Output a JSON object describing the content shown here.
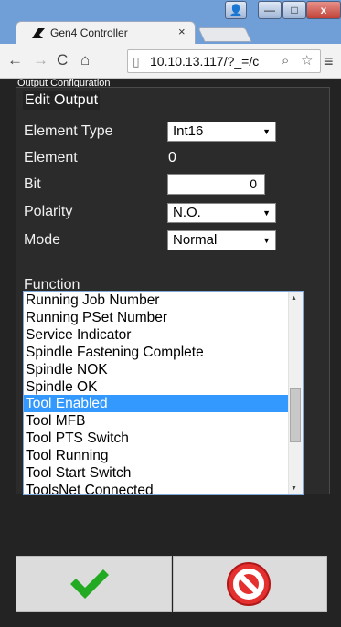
{
  "browser": {
    "tab_title": "Gen4 Controller",
    "tab_close": "×",
    "url": "10.10.13.117/?_=/c",
    "icons": [
      "back-icon",
      "forward-icon",
      "reload-icon",
      "home-icon",
      "page-icon",
      "zoom-icon",
      "star-icon",
      "menu-icon"
    ],
    "window_buttons": {
      "minimize": "—",
      "maximize": "□",
      "close": "x"
    }
  },
  "page": {
    "config_title": "Output Configuration",
    "section_title": "Edit Output",
    "labels": {
      "element_type": "Element Type",
      "element": "Element",
      "bit": "Bit",
      "polarity": "Polarity",
      "mode": "Mode",
      "function": "Function"
    },
    "element_type_value": "Int16",
    "element_value": "0",
    "bit_value": "0",
    "polarity_value": "N.O.",
    "mode_value": "Normal",
    "function_items": [
      "Running Job Number",
      "Running PSet Number",
      "Service Indicator",
      "Spindle Fastening Complete",
      "Spindle NOK",
      "Spindle OK",
      "Tool Enabled",
      "Tool MFB",
      "Tool PTS Switch",
      "Tool Running",
      "Tool Start Switch",
      "ToolsNet Connected"
    ],
    "selected_function": "Tool Enabled"
  },
  "colors": {
    "selection": "#3399ff",
    "ok": "#22aa22",
    "cancel": "#e53030"
  }
}
